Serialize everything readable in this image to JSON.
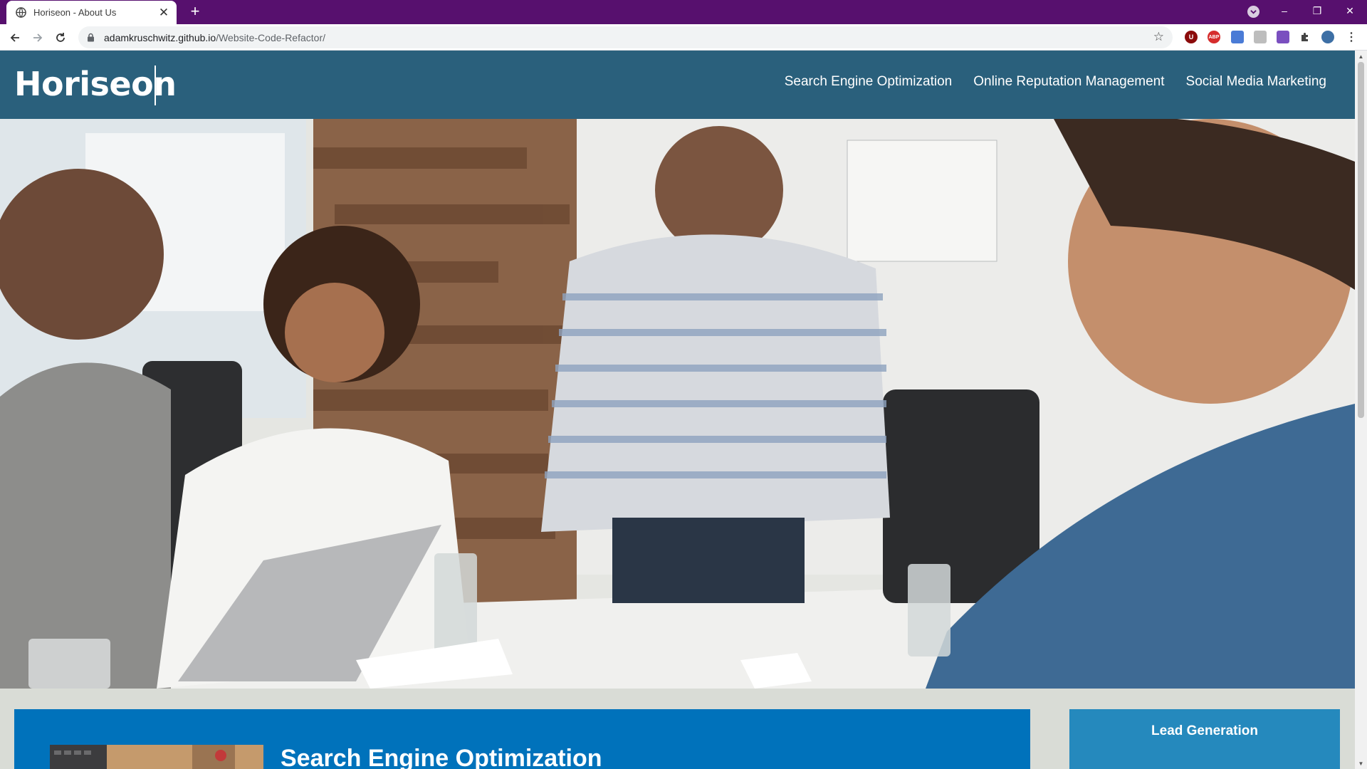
{
  "browser": {
    "tab_title": "Horiseon - About Us",
    "tab_close": "✕",
    "new_tab": "+",
    "url_host": "adamkruschwitz.github.io",
    "url_path": "/Website-Code-Refactor/",
    "window_controls": {
      "minimize": "–",
      "restore": "❐",
      "close": "✕"
    },
    "extensions": [
      "U",
      "ABP",
      "",
      "",
      "",
      ""
    ],
    "accent_color": "#57106e"
  },
  "site": {
    "logo": "Horiseon",
    "nav": [
      {
        "label": "Search Engine Optimization"
      },
      {
        "label": "Online Reputation Management"
      },
      {
        "label": "Social Media Marketing"
      }
    ],
    "header_color": "#2a607c",
    "hero_alt": "Team meeting around a table",
    "content": {
      "card_title": "Search Engine Optimization",
      "card_color": "#0072bb"
    },
    "sidebar": {
      "title": "Lead Generation",
      "color": "#2589bd"
    }
  }
}
